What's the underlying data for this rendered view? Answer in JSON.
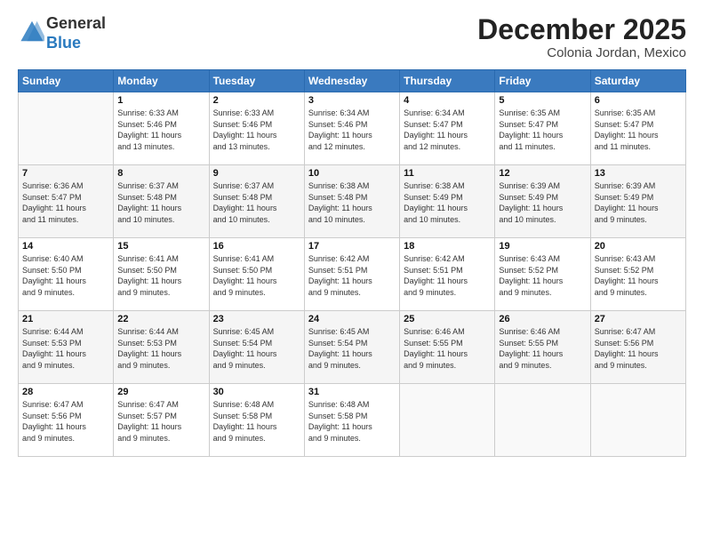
{
  "logo": {
    "general": "General",
    "blue": "Blue"
  },
  "title": "December 2025",
  "subtitle": "Colonia Jordan, Mexico",
  "days_header": [
    "Sunday",
    "Monday",
    "Tuesday",
    "Wednesday",
    "Thursday",
    "Friday",
    "Saturday"
  ],
  "weeks": [
    [
      {
        "day": "",
        "info": ""
      },
      {
        "day": "1",
        "info": "Sunrise: 6:33 AM\nSunset: 5:46 PM\nDaylight: 11 hours\nand 13 minutes."
      },
      {
        "day": "2",
        "info": "Sunrise: 6:33 AM\nSunset: 5:46 PM\nDaylight: 11 hours\nand 13 minutes."
      },
      {
        "day": "3",
        "info": "Sunrise: 6:34 AM\nSunset: 5:46 PM\nDaylight: 11 hours\nand 12 minutes."
      },
      {
        "day": "4",
        "info": "Sunrise: 6:34 AM\nSunset: 5:47 PM\nDaylight: 11 hours\nand 12 minutes."
      },
      {
        "day": "5",
        "info": "Sunrise: 6:35 AM\nSunset: 5:47 PM\nDaylight: 11 hours\nand 11 minutes."
      },
      {
        "day": "6",
        "info": "Sunrise: 6:35 AM\nSunset: 5:47 PM\nDaylight: 11 hours\nand 11 minutes."
      }
    ],
    [
      {
        "day": "7",
        "info": "Sunrise: 6:36 AM\nSunset: 5:47 PM\nDaylight: 11 hours\nand 11 minutes."
      },
      {
        "day": "8",
        "info": "Sunrise: 6:37 AM\nSunset: 5:48 PM\nDaylight: 11 hours\nand 10 minutes."
      },
      {
        "day": "9",
        "info": "Sunrise: 6:37 AM\nSunset: 5:48 PM\nDaylight: 11 hours\nand 10 minutes."
      },
      {
        "day": "10",
        "info": "Sunrise: 6:38 AM\nSunset: 5:48 PM\nDaylight: 11 hours\nand 10 minutes."
      },
      {
        "day": "11",
        "info": "Sunrise: 6:38 AM\nSunset: 5:49 PM\nDaylight: 11 hours\nand 10 minutes."
      },
      {
        "day": "12",
        "info": "Sunrise: 6:39 AM\nSunset: 5:49 PM\nDaylight: 11 hours\nand 10 minutes."
      },
      {
        "day": "13",
        "info": "Sunrise: 6:39 AM\nSunset: 5:49 PM\nDaylight: 11 hours\nand 9 minutes."
      }
    ],
    [
      {
        "day": "14",
        "info": "Sunrise: 6:40 AM\nSunset: 5:50 PM\nDaylight: 11 hours\nand 9 minutes."
      },
      {
        "day": "15",
        "info": "Sunrise: 6:41 AM\nSunset: 5:50 PM\nDaylight: 11 hours\nand 9 minutes."
      },
      {
        "day": "16",
        "info": "Sunrise: 6:41 AM\nSunset: 5:50 PM\nDaylight: 11 hours\nand 9 minutes."
      },
      {
        "day": "17",
        "info": "Sunrise: 6:42 AM\nSunset: 5:51 PM\nDaylight: 11 hours\nand 9 minutes."
      },
      {
        "day": "18",
        "info": "Sunrise: 6:42 AM\nSunset: 5:51 PM\nDaylight: 11 hours\nand 9 minutes."
      },
      {
        "day": "19",
        "info": "Sunrise: 6:43 AM\nSunset: 5:52 PM\nDaylight: 11 hours\nand 9 minutes."
      },
      {
        "day": "20",
        "info": "Sunrise: 6:43 AM\nSunset: 5:52 PM\nDaylight: 11 hours\nand 9 minutes."
      }
    ],
    [
      {
        "day": "21",
        "info": "Sunrise: 6:44 AM\nSunset: 5:53 PM\nDaylight: 11 hours\nand 9 minutes."
      },
      {
        "day": "22",
        "info": "Sunrise: 6:44 AM\nSunset: 5:53 PM\nDaylight: 11 hours\nand 9 minutes."
      },
      {
        "day": "23",
        "info": "Sunrise: 6:45 AM\nSunset: 5:54 PM\nDaylight: 11 hours\nand 9 minutes."
      },
      {
        "day": "24",
        "info": "Sunrise: 6:45 AM\nSunset: 5:54 PM\nDaylight: 11 hours\nand 9 minutes."
      },
      {
        "day": "25",
        "info": "Sunrise: 6:46 AM\nSunset: 5:55 PM\nDaylight: 11 hours\nand 9 minutes."
      },
      {
        "day": "26",
        "info": "Sunrise: 6:46 AM\nSunset: 5:55 PM\nDaylight: 11 hours\nand 9 minutes."
      },
      {
        "day": "27",
        "info": "Sunrise: 6:47 AM\nSunset: 5:56 PM\nDaylight: 11 hours\nand 9 minutes."
      }
    ],
    [
      {
        "day": "28",
        "info": "Sunrise: 6:47 AM\nSunset: 5:56 PM\nDaylight: 11 hours\nand 9 minutes."
      },
      {
        "day": "29",
        "info": "Sunrise: 6:47 AM\nSunset: 5:57 PM\nDaylight: 11 hours\nand 9 minutes."
      },
      {
        "day": "30",
        "info": "Sunrise: 6:48 AM\nSunset: 5:58 PM\nDaylight: 11 hours\nand 9 minutes."
      },
      {
        "day": "31",
        "info": "Sunrise: 6:48 AM\nSunset: 5:58 PM\nDaylight: 11 hours\nand 9 minutes."
      },
      {
        "day": "",
        "info": ""
      },
      {
        "day": "",
        "info": ""
      },
      {
        "day": "",
        "info": ""
      }
    ]
  ]
}
